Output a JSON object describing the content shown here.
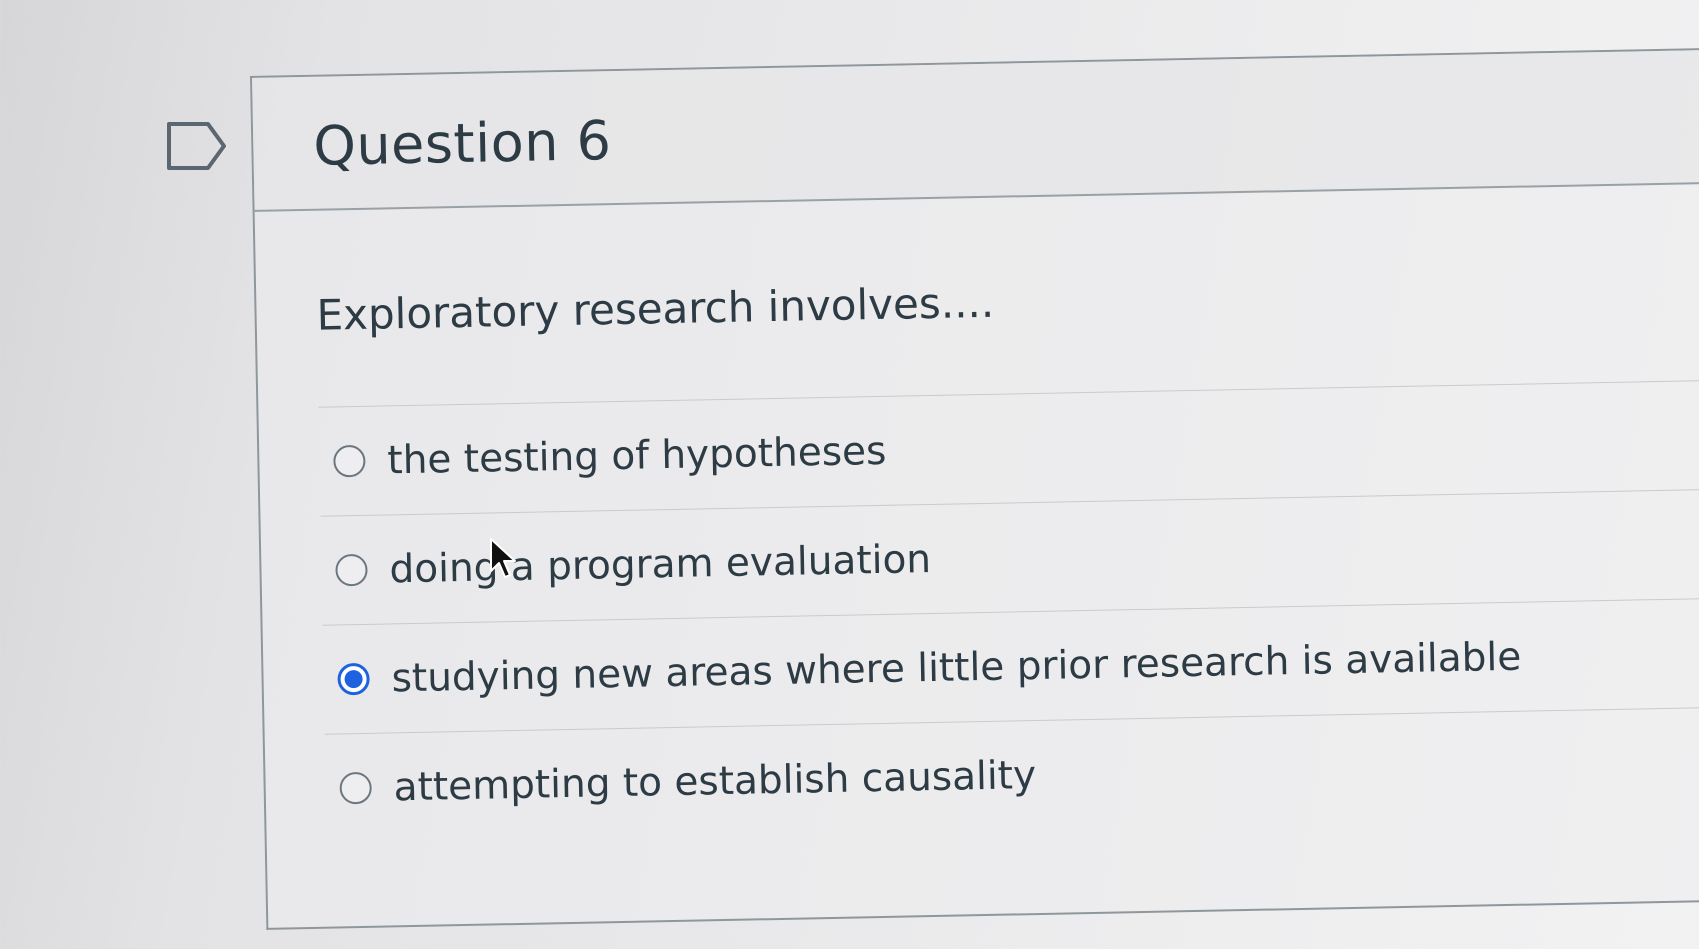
{
  "question": {
    "title": "Question 6",
    "text": "Exploratory research involves....",
    "answers": [
      {
        "label": "the testing of hypotheses",
        "selected": false
      },
      {
        "label": "doing a program evaluation",
        "selected": false
      },
      {
        "label": "studying new areas where little prior research is available",
        "selected": true
      },
      {
        "label": "attempting to establish causality",
        "selected": false
      }
    ]
  },
  "colors": {
    "text": "#2d3b45",
    "selected_radio": "#1f62e0",
    "border": "#8f979c"
  },
  "icons": {
    "flag": "flag-outline-icon",
    "cursor": "mouse-pointer-icon"
  }
}
